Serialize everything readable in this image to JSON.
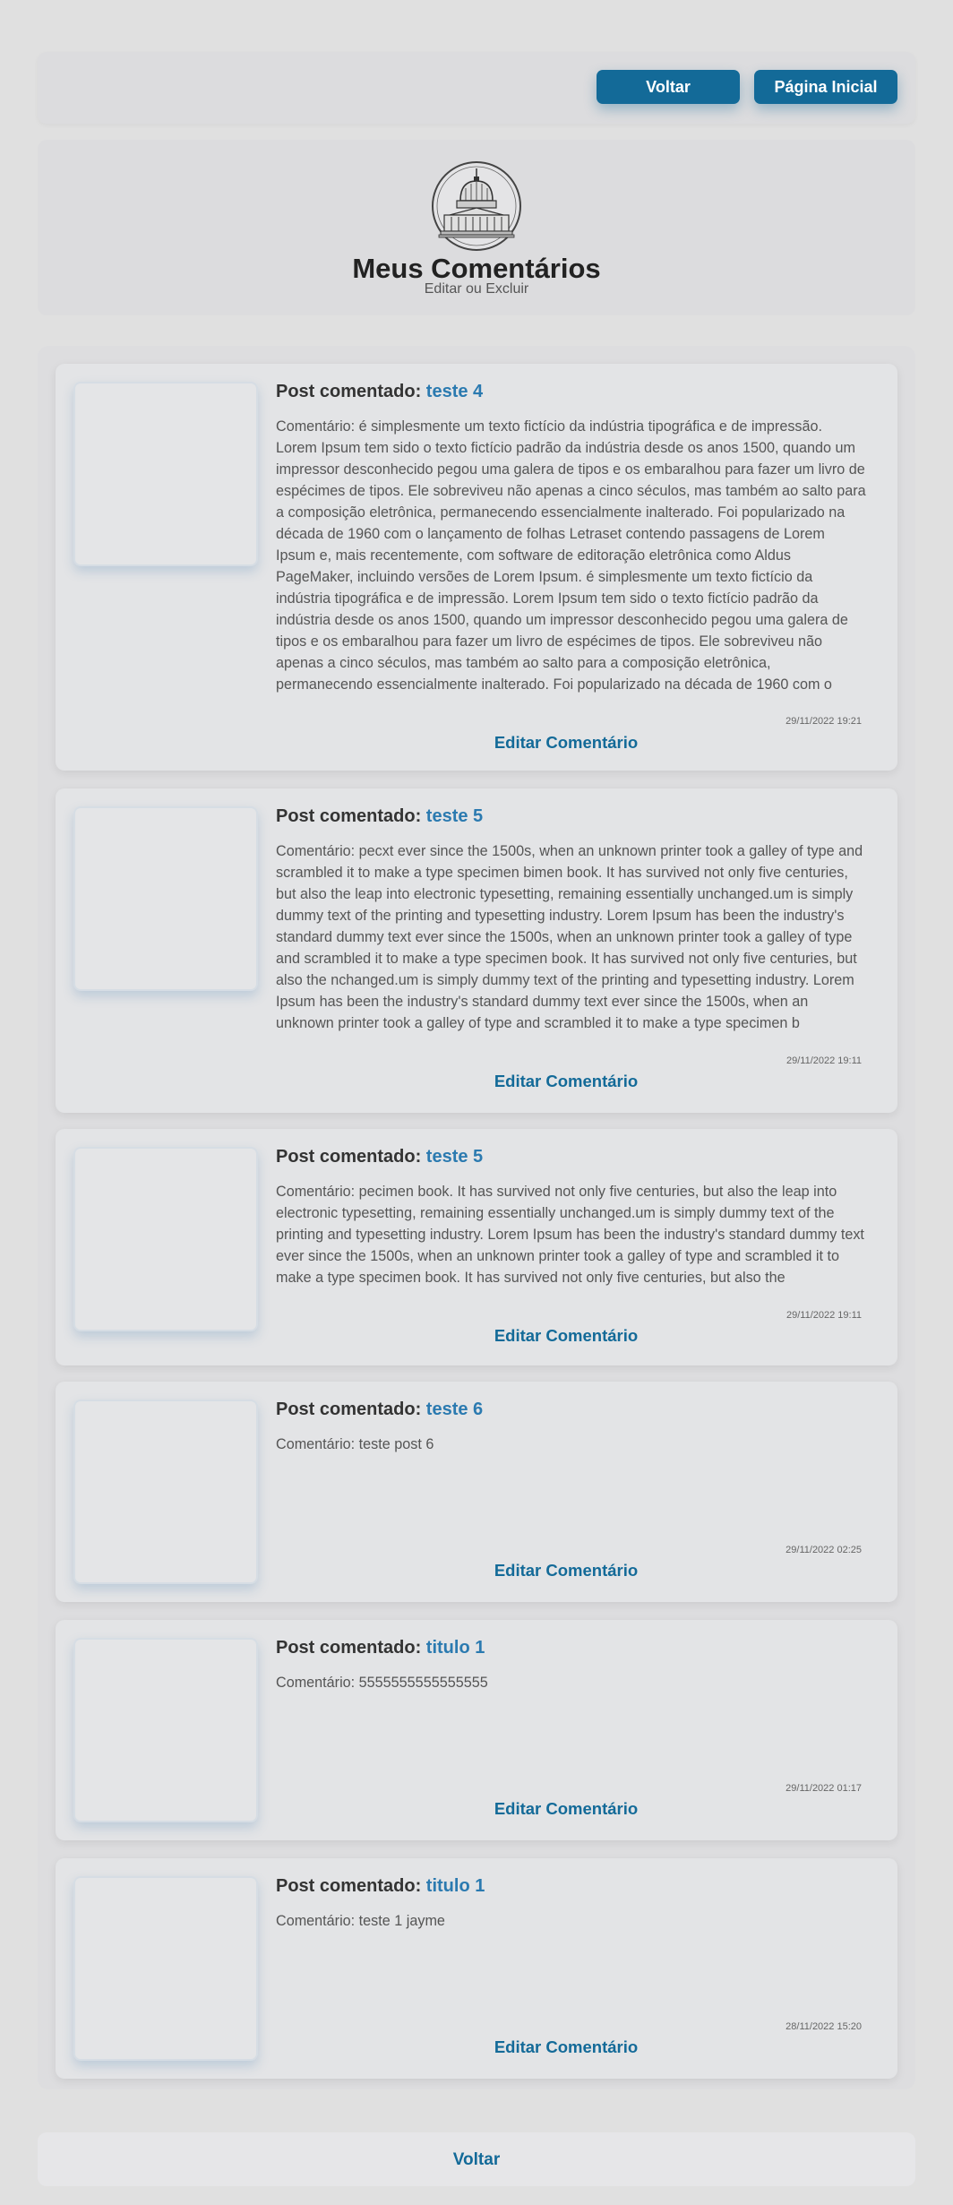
{
  "nav": {
    "back_label": "Voltar",
    "home_label": "Página Inicial"
  },
  "header": {
    "title": "Meus Comentários",
    "subtitle": "Editar ou Excluir"
  },
  "comments": [
    {
      "post_prefix": "Post comentado: ",
      "post_title": "teste 4",
      "text": "Comentário: é simplesmente um texto fictício da indústria tipográfica e de impressão. Lorem Ipsum tem sido o texto fictício padrão da indústria desde os anos 1500, quando um impressor desconhecido pegou uma galera de tipos e os embaralhou para fazer um livro de espécimes de tipos. Ele sobreviveu não apenas a cinco séculos, mas também ao salto para a composição eletrônica, permanecendo essencialmente inalterado. Foi popularizado na década de 1960 com o lançamento de folhas Letraset contendo passagens de Lorem Ipsum e, mais recentemente, com software de editoração eletrônica como Aldus PageMaker, incluindo versões de Lorem Ipsum. é simplesmente um texto fictício da indústria tipográfica e de impressão. Lorem Ipsum tem sido o texto fictício padrão da indústria desde os anos 1500, quando um impressor desconhecido pegou uma galera de tipos e os embaralhou para fazer um livro de espécimes de tipos. Ele sobreviveu não apenas a cinco séculos, mas também ao salto para a composição eletrônica, permanecendo essencialmente inalterado. Foi popularizado na década de 1960 com o",
      "date": "29/11/2022 19:21",
      "edit_label": "Editar Comentário"
    },
    {
      "post_prefix": "Post comentado: ",
      "post_title": "teste 5",
      "text": "Comentário: pecxt ever since the 1500s, when an unknown printer took a galley of type and scrambled it to make a type specimen bimen book. It has survived not only five centuries, but also the leap into electronic typesetting, remaining essentially unchanged.um is simply dummy text of the printing and typesetting industry. Lorem Ipsum has been the industry's standard dummy text ever since the 1500s, when an unknown printer took a galley of type and scrambled it to make a type specimen book. It has survived not only five centuries, but also the nchanged.um is simply dummy text of the printing and typesetting industry. Lorem Ipsum has been the industry's standard dummy text ever since the 1500s, when an unknown printer took a galley of type and scrambled it to make a type specimen b",
      "date": "29/11/2022 19:11",
      "edit_label": "Editar Comentário"
    },
    {
      "post_prefix": "Post comentado: ",
      "post_title": "teste 5",
      "text": "Comentário: pecimen book. It has survived not only five centuries, but also the leap into electronic typesetting, remaining essentially unchanged.um is simply dummy text of the printing and typesetting industry. Lorem Ipsum has been the industry's standard dummy text ever since the 1500s, when an unknown printer took a galley of type and scrambled it to make a type specimen book. It has survived not only five centuries, but also the",
      "date": "29/11/2022 19:11",
      "edit_label": "Editar Comentário"
    },
    {
      "post_prefix": "Post comentado: ",
      "post_title": "teste 6",
      "text": "Comentário: teste post 6",
      "date": "29/11/2022 02:25",
      "edit_label": "Editar Comentário"
    },
    {
      "post_prefix": "Post comentado: ",
      "post_title": "titulo 1",
      "text": "Comentário: 5555555555555555",
      "date": "29/11/2022 01:17",
      "edit_label": "Editar Comentário"
    },
    {
      "post_prefix": "Post comentado: ",
      "post_title": "titulo 1",
      "text": "Comentário: teste 1 jayme",
      "date": "28/11/2022 15:20",
      "edit_label": "Editar Comentário"
    }
  ],
  "footer": {
    "back_label": "Voltar"
  },
  "colors": {
    "primary": "#136a98",
    "link": "#2b7ab0",
    "background": "#e0e0e0"
  },
  "icons": {
    "logo": "capitol-building-icon"
  }
}
